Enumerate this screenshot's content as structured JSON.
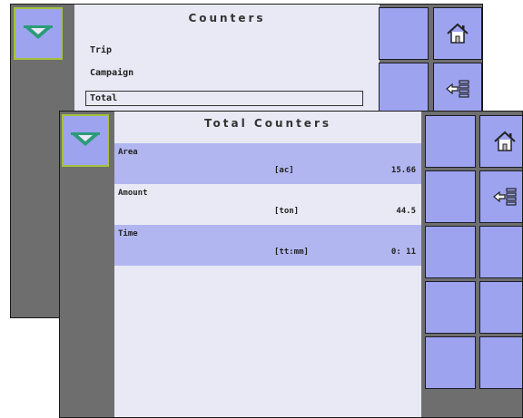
{
  "colors": {
    "screen_bg": "#6e6e6e",
    "panel_bg": "#e9e9f5",
    "tile": "#9da3ef",
    "row_highlight": "#b2b6f0",
    "icon_green": "#2c9b7a"
  },
  "back_screen": {
    "title": "Counters",
    "menu": [
      {
        "label": "Trip"
      },
      {
        "label": "Campaign"
      },
      {
        "label": "Total",
        "selected": true
      }
    ],
    "icons": {
      "app": "spreader-icon",
      "home": "home-icon",
      "back": "back-arrow-icon"
    }
  },
  "front_screen": {
    "title": "Total Counters",
    "rows": [
      {
        "label": "Area",
        "unit": "[ac]",
        "value": "15.66",
        "highlighted": true
      },
      {
        "label": "Amount",
        "unit": "[ton]",
        "value": "44.5",
        "highlighted": false
      },
      {
        "label": "Time",
        "unit": "[tt:mm]",
        "value": "0: 11",
        "highlighted": true
      }
    ],
    "icons": {
      "app": "spreader-icon",
      "home": "home-icon",
      "back": "back-arrow-icon"
    }
  }
}
